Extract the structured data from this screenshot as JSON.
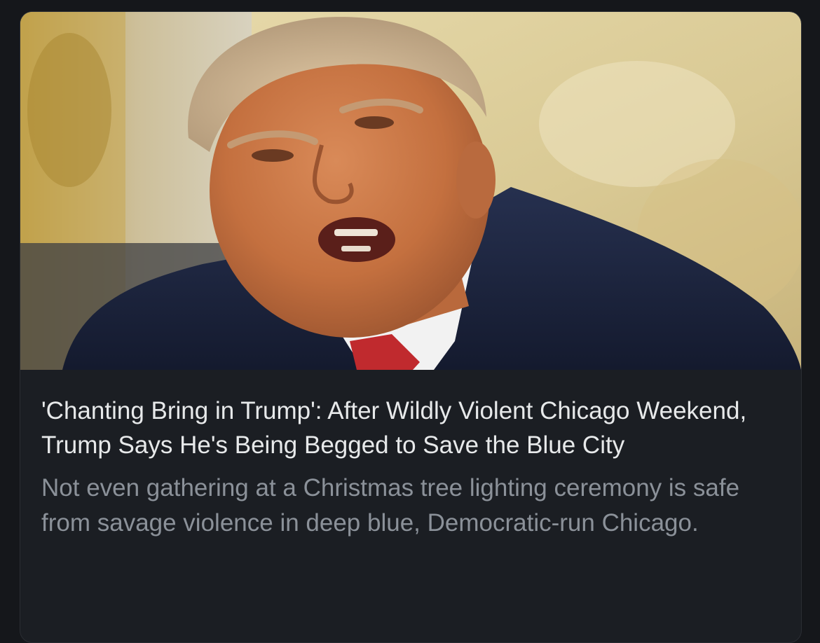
{
  "article_card": {
    "headline": "'Chanting Bring in Trump': After Wildly Violent Chicago Weekend, Trump Says He's Being Begged to Save the Blue City",
    "summary": "Not even gathering at a Christmas tree lighting ceremony is safe from savage violence in deep blue, Democratic-run Chicago."
  }
}
